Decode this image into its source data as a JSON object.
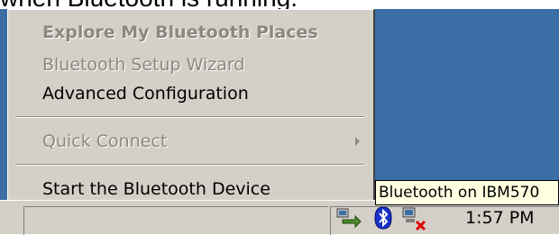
{
  "caption_text": "when Bluetooth is running.",
  "menu": {
    "items": [
      {
        "label": "Explore My Bluetooth Places",
        "state": "disabled-bold"
      },
      {
        "label": "Bluetooth Setup Wizard",
        "state": "disabled"
      },
      {
        "label": "Advanced Configuration",
        "state": "enabled"
      },
      {
        "label": "Quick Connect",
        "state": "disabled",
        "submenu": true
      },
      {
        "label": "Start the Bluetooth Device",
        "state": "enabled"
      }
    ]
  },
  "tooltip": {
    "text": "Bluetooth on IBM570"
  },
  "tray": {
    "icons": [
      "network-drive-icon",
      "bluetooth-icon",
      "network-disconnected-icon"
    ],
    "clock": "1:57 PM"
  },
  "colors": {
    "desktop": "#3a6ea5",
    "menu_face": "#d4d0c8",
    "tooltip_bg": "#ffffe1",
    "disabled_text": "#8b887f"
  }
}
